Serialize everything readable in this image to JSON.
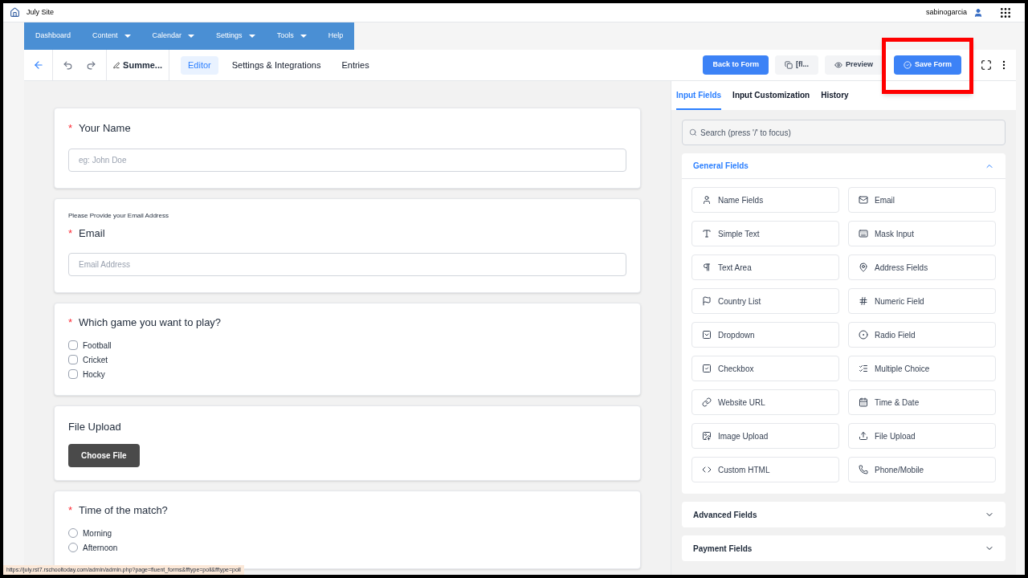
{
  "site": {
    "title": "July Site",
    "user": "sabinogarcia"
  },
  "nav": [
    {
      "label": "Dashboard",
      "dropdown": false
    },
    {
      "label": "Content",
      "dropdown": true
    },
    {
      "label": "Calendar",
      "dropdown": true
    },
    {
      "label": "Settings",
      "dropdown": true
    },
    {
      "label": "Tools",
      "dropdown": true
    },
    {
      "label": "Help",
      "dropdown": false
    }
  ],
  "toolbar": {
    "form_name": "Summe...",
    "tabs": [
      {
        "label": "Editor",
        "selected": true
      },
      {
        "label": "Settings & Integrations",
        "selected": false
      },
      {
        "label": "Entries",
        "selected": false
      }
    ],
    "shortcode": "[fl...",
    "back": "Back to Form",
    "preview": "Preview",
    "save": "Save Form",
    "save_highlighted": true
  },
  "form": [
    {
      "kind": "text",
      "label": "Your Name",
      "required_mark": "*",
      "placeholder": "eg: John Doe"
    },
    {
      "kind": "text",
      "help": "Please Provide your Email Address",
      "label": "Email",
      "required_mark": "*",
      "placeholder": "Email Address"
    },
    {
      "kind": "checkboxes",
      "label": "Which game you want to play?",
      "required_mark": "*",
      "options": [
        {
          "label": "Football",
          "checked": false
        },
        {
          "label": "Cricket",
          "checked": false
        },
        {
          "label": "Hocky",
          "checked": false
        }
      ]
    },
    {
      "kind": "file",
      "label": "File Upload",
      "button": "Choose File"
    },
    {
      "kind": "radio",
      "label": "Time of the match?",
      "required_mark": "*",
      "options": [
        {
          "label": "Morning",
          "selected": false
        },
        {
          "label": "Afternoon",
          "selected": false
        }
      ]
    }
  ],
  "panel": {
    "tabs": [
      {
        "label": "Input Fields",
        "selected": true
      },
      {
        "label": "Input Customization",
        "selected": false
      },
      {
        "label": "History",
        "selected": false
      }
    ],
    "search_placeholder": "Search (press '/' to focus)",
    "sections": [
      {
        "title": "General Fields",
        "expanded": true,
        "items": [
          "Name Fields",
          "Email",
          "Simple Text",
          "Mask Input",
          "Text Area",
          "Address Fields",
          "Country List",
          "Numeric Field",
          "Dropdown",
          "Radio Field",
          "Checkbox",
          "Multiple Choice",
          "Website URL",
          "Time & Date",
          "Image Upload",
          "File Upload",
          "Custom HTML",
          "Phone/Mobile"
        ]
      },
      {
        "title": "Advanced Fields",
        "expanded": false
      },
      {
        "title": "Payment Fields",
        "expanded": false
      }
    ]
  },
  "status_url": "https://july.rst7.rschooltoday.com/admin/admin.php?page=fluent_forms&fftype=poll&fftype=poll"
}
